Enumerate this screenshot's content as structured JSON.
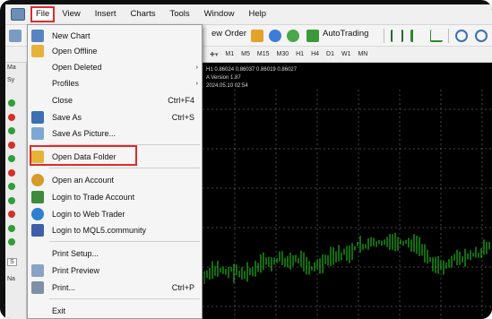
{
  "menubar": {
    "items": [
      "File",
      "View",
      "Insert",
      "Charts",
      "Tools",
      "Window",
      "Help"
    ]
  },
  "toolbar": {
    "new_order_label": "ew Order",
    "autotrading_label": "AutoTrading"
  },
  "timeframes": [
    "M1",
    "M5",
    "M15",
    "M30",
    "H1",
    "H4",
    "D1",
    "W1",
    "MN"
  ],
  "left_panel": {
    "market_tab": "Ma",
    "symbol_label": "Sy",
    "nav_tab": "Na",
    "input_label": "S"
  },
  "chart": {
    "info_line1": "H1  0.86024 0.86037 0.86019 0.86027",
    "info_line2": "A Version 1.87",
    "info_line3": "2024.05.10 02:54",
    "colors": {
      "background": "#000000",
      "candles": "#22c41a",
      "grid": "#8a8a8a"
    }
  },
  "file_menu": {
    "items": [
      {
        "label": "New Chart",
        "shortcut": "",
        "icon": "new-chart-icon"
      },
      {
        "label": "Open Offline",
        "shortcut": "",
        "icon": "folder-icon"
      },
      {
        "label": "Open Deleted",
        "shortcut": "",
        "icon": ""
      },
      {
        "label": "Profiles",
        "shortcut": "",
        "icon": ""
      },
      {
        "label": "Close",
        "shortcut": "Ctrl+F4",
        "icon": ""
      },
      {
        "label": "Save As",
        "shortcut": "Ctrl+S",
        "icon": "save-icon"
      },
      {
        "label": "Save As Picture...",
        "shortcut": "",
        "icon": "picture-icon"
      },
      {
        "label": "Open Data Folder",
        "shortcut": "",
        "icon": "folder-icon"
      },
      {
        "label": "Open an Account",
        "shortcut": "",
        "icon": "account-icon"
      },
      {
        "label": "Login to Trade Account",
        "shortcut": "",
        "icon": "login-icon"
      },
      {
        "label": "Login to Web Trader",
        "shortcut": "",
        "icon": "web-icon"
      },
      {
        "label": "Login to MQL5.community",
        "shortcut": "",
        "icon": "mql5-icon"
      },
      {
        "label": "Print Setup...",
        "shortcut": "",
        "icon": ""
      },
      {
        "label": "Print Preview",
        "shortcut": "",
        "icon": "print-preview-icon"
      },
      {
        "label": "Print...",
        "shortcut": "Ctrl+P",
        "icon": "printer-icon"
      },
      {
        "label": "Exit",
        "shortcut": "",
        "icon": ""
      }
    ],
    "submenu_arrow": "›"
  },
  "highlight_color": "#e02a2a"
}
